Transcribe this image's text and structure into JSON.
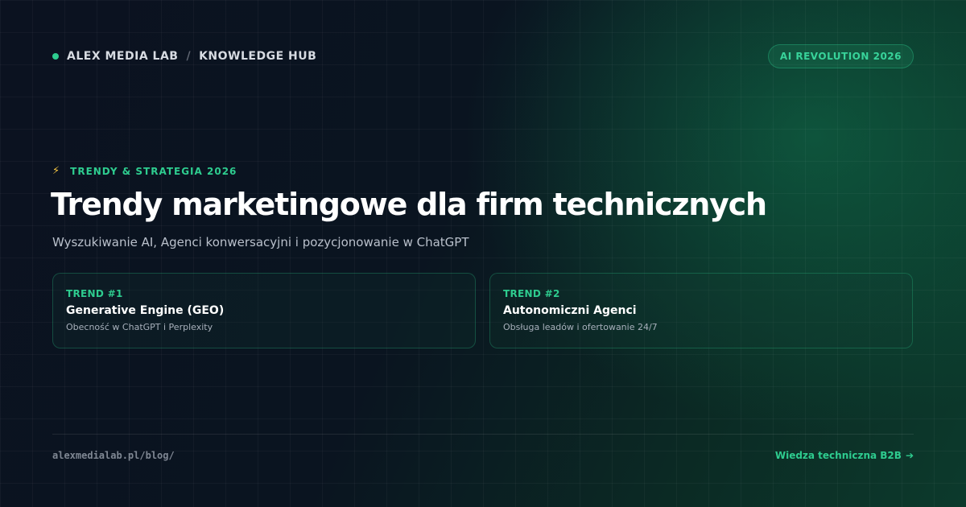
{
  "header": {
    "brand": "ALEX MEDIA LAB",
    "separator": "/",
    "section": "KNOWLEDGE HUB",
    "badge": "AI REVOLUTION 2026"
  },
  "hero": {
    "eyebrow_icon": "lightning-icon",
    "eyebrow": "TRENDY & STRATEGIA 2026",
    "title": "Trendy marketingowe dla firm technicznych",
    "subtitle": "Wyszukiwanie AI, Agenci konwersacyjni i pozycjonowanie w ChatGPT"
  },
  "cards": [
    {
      "label": "TREND #1",
      "title": "Generative Engine (GEO)",
      "description": "Obecność w ChatGPT i Perplexity"
    },
    {
      "label": "TREND #2",
      "title": "Autonomiczni Agenci",
      "description": "Obsługa leadów i ofertowanie 24/7"
    }
  ],
  "footer": {
    "url": "alexmedialab.pl/blog/",
    "link": "Wiedza techniczna B2B",
    "link_icon": "arrow-right-icon"
  },
  "colors": {
    "accent": "#2ecc8f",
    "background": "#0a0f1a",
    "eyebrow_icon": "#f5c542"
  }
}
